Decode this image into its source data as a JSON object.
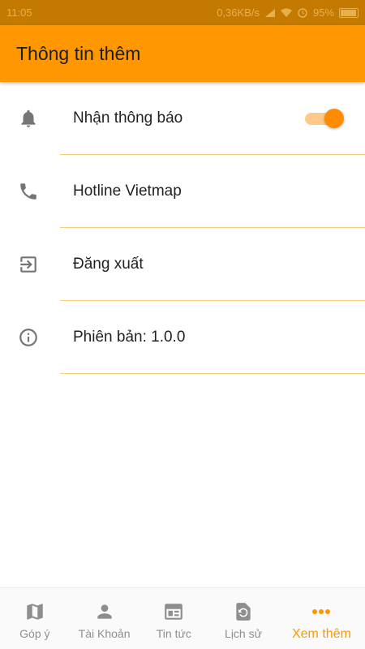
{
  "status_bar": {
    "time": "11:05",
    "speed": "0,36KB/s",
    "battery": "95%"
  },
  "app_bar": {
    "title": "Thông tin thêm"
  },
  "items": [
    {
      "label": "Nhận thông báo",
      "icon": "bell-icon",
      "toggle_on": true
    },
    {
      "label": "Hotline Vietmap",
      "icon": "phone-icon"
    },
    {
      "label": "Đăng xuất",
      "icon": "logout-icon"
    },
    {
      "label": "Phiên bản: 1.0.0",
      "icon": "info-icon"
    }
  ],
  "bottom_nav": [
    {
      "label": "Góp ý",
      "icon": "map-icon"
    },
    {
      "label": "Tài Khoản",
      "icon": "person-icon"
    },
    {
      "label": "Tin tức",
      "icon": "news-icon"
    },
    {
      "label": "Lịch sử",
      "icon": "history-icon"
    },
    {
      "label": "Xem thêm",
      "icon": "more-icon",
      "active": true
    }
  ],
  "colors": {
    "primary": "#ff9800",
    "divider": "#f5cf79",
    "inactive": "#8e8e8e"
  }
}
